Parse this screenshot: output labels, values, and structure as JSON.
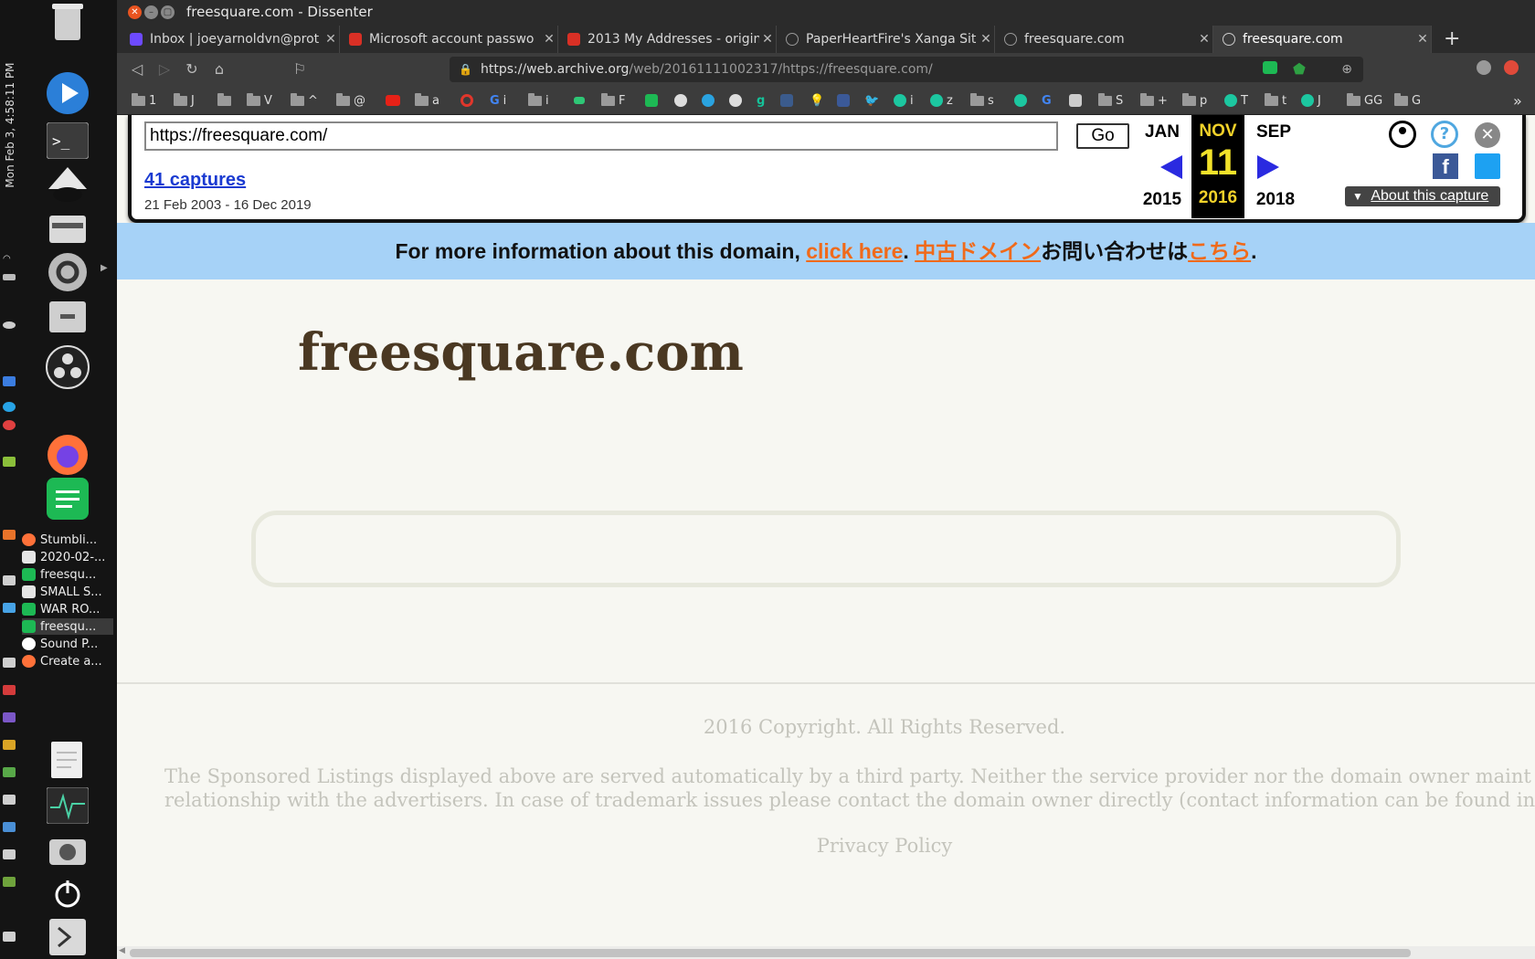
{
  "desktop": {
    "clock": "Mon Feb 3, 4:58:11 PM",
    "open_windows": [
      {
        "label": "Stumbli...",
        "icon": "firefox-icon"
      },
      {
        "label": "2020-02-...",
        "icon": "text-editor-icon"
      },
      {
        "label": "freesqu...",
        "icon": "dissenter-icon"
      },
      {
        "label": "SMALL S...",
        "icon": "text-editor-icon"
      },
      {
        "label": "WAR RO...",
        "icon": "dissenter-icon"
      },
      {
        "label": "freesqu...",
        "icon": "dissenter-icon"
      },
      {
        "label": "Sound P...",
        "icon": "sound-icon"
      },
      {
        "label": "Create a...",
        "icon": "firefox-icon"
      }
    ]
  },
  "window": {
    "title": "freesquare.com - Dissenter"
  },
  "tabs": [
    {
      "label": "Inbox | joeyarnoldvn@prot",
      "icon": "lock-icon"
    },
    {
      "label": "Microsoft account passwo",
      "icon": "gmail-icon"
    },
    {
      "label": "2013 My Addresses - origin",
      "icon": "gmail-icon"
    },
    {
      "label": "PaperHeartFire's Xanga Sit",
      "icon": "globe-icon"
    },
    {
      "label": "freesquare.com",
      "icon": "globe-icon"
    },
    {
      "label": "freesquare.com",
      "icon": "globe-icon",
      "active": true
    }
  ],
  "address_bar": {
    "host": "https://web.archive.org",
    "path": "/web/20161111002317/https://freesquare.com/"
  },
  "bookmarks": [
    "1",
    "J",
    "",
    "V",
    "^",
    "@",
    "",
    "a",
    "",
    "i",
    "",
    "i",
    "",
    "F",
    "",
    "",
    "",
    "",
    "",
    "",
    "",
    "",
    "",
    "i",
    "z",
    "s",
    "",
    "",
    "",
    "",
    "S",
    "+",
    "p",
    "T",
    "t",
    "J",
    "GG",
    "G"
  ],
  "wayback": {
    "url_value": "https://freesquare.com/",
    "go_label": "Go",
    "captures": "41 captures",
    "range": "21 Feb 2003 - 16 Dec 2019",
    "prev_month": "JAN",
    "cur_month": "NOV",
    "next_month": "SEP",
    "cur_day": "11",
    "prev_year": "2015",
    "cur_year": "2016",
    "next_year": "2018",
    "about_label": "About this capture"
  },
  "banner": {
    "text": "For more information about this domain, ",
    "link1": "click here",
    "sep": ". ",
    "jp_link": "中古ドメイン",
    "jp_text": "お問い合わせは",
    "jp_link2": "こちら",
    "end": "."
  },
  "site": {
    "title": "freesquare.com",
    "copyright": "2016 Copyright. All Rights Reserved.",
    "disclaimer_line1": "The Sponsored Listings displayed above are served automatically by a third party. Neither the service provider nor the domain owner maint",
    "disclaimer_line2": "relationship with the advertisers. In case of trademark issues please contact the domain owner directly (contact information can be found in",
    "privacy": "Privacy Policy"
  }
}
